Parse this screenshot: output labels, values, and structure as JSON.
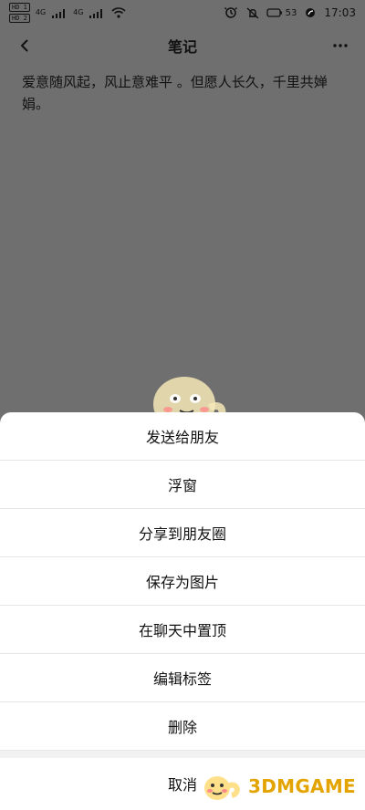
{
  "status_bar": {
    "left": {
      "hd_badges": [
        "HD 1",
        "HD 2"
      ],
      "net_labels": [
        "4G",
        "4G"
      ]
    },
    "right": {
      "battery_label": "53",
      "time": "17:03"
    }
  },
  "app_bar": {
    "title": "笔记"
  },
  "note": {
    "text": "爱意随风起，风止意难平 。但愿人长久，千里共婵娟。"
  },
  "sheet": {
    "items": [
      "发送给朋友",
      "浮窗",
      "分享到朋友圈",
      "保存为图片",
      "在聊天中置顶",
      "编辑标签",
      "删除"
    ],
    "cancel": "取消"
  },
  "watermark": {
    "text": "3DMGAME"
  }
}
